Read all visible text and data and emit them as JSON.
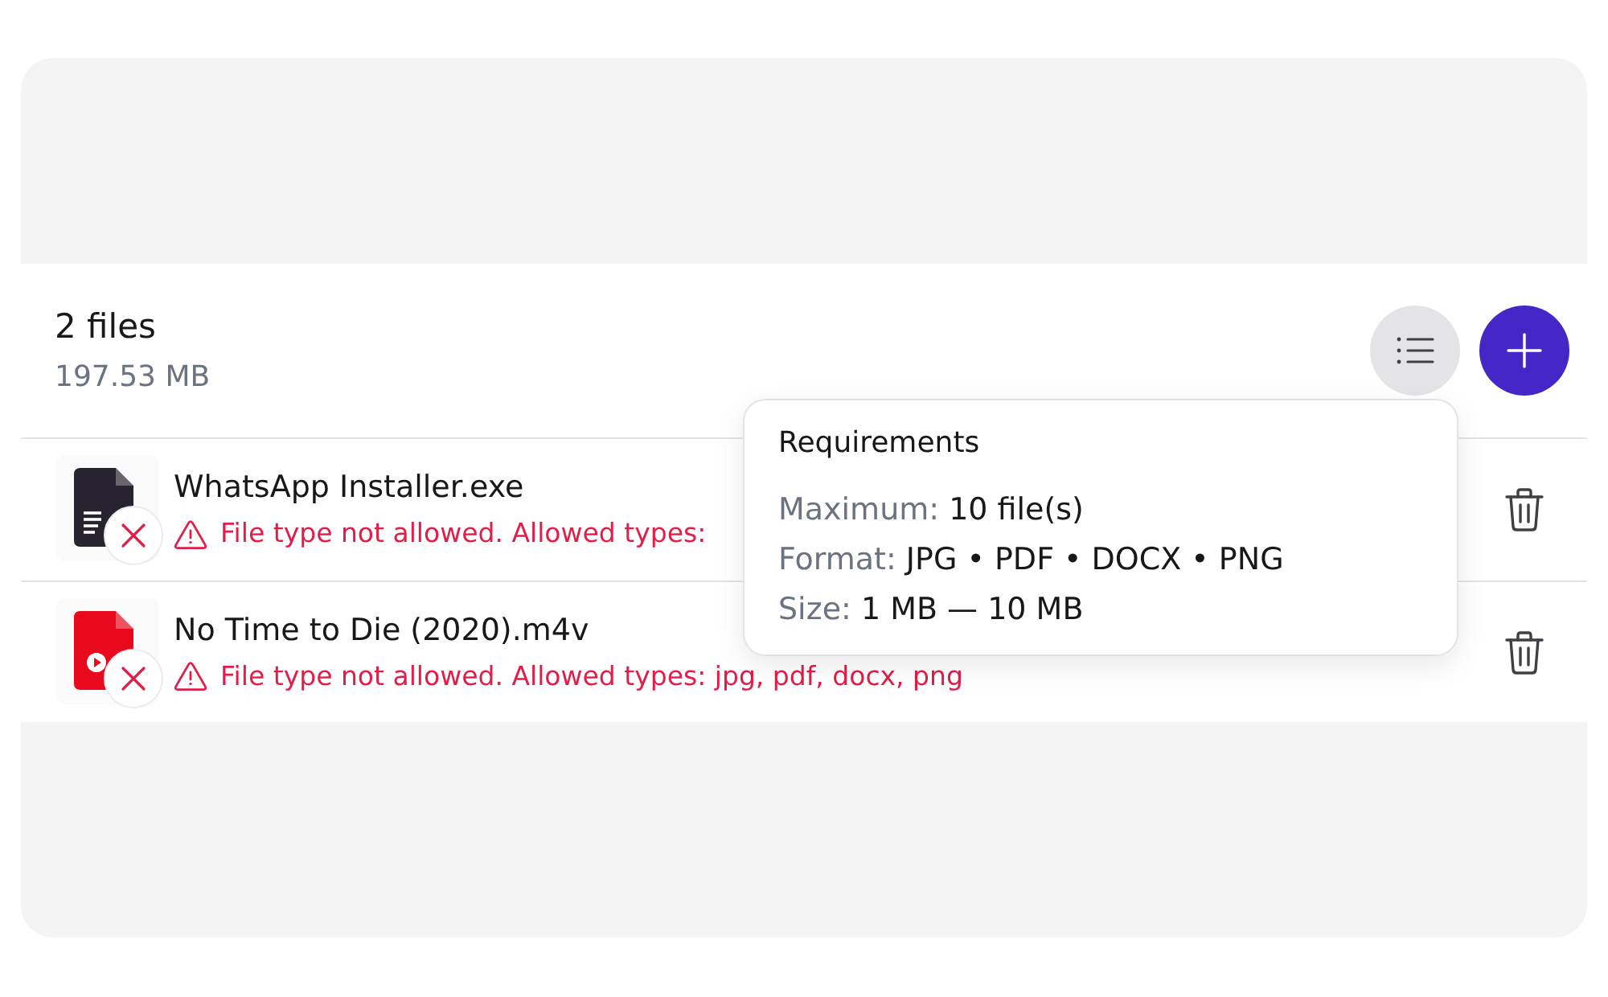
{
  "summary": {
    "title": "2 files",
    "size": "197.53 MB"
  },
  "requirements_toggle": {
    "expanded": true
  },
  "requirements": {
    "title": "Requirements",
    "items": [
      {
        "label": "Maximum:",
        "value": "10 file(s)"
      },
      {
        "label": "Format:",
        "value": "JPG • PDF • DOCX • PNG"
      },
      {
        "label": "Size:",
        "value": "1 MB — 10 MB"
      }
    ]
  },
  "files": [
    {
      "kind": "document",
      "color": "#27232f",
      "name": "WhatsApp Installer.exe",
      "error": "File type not allowed. Allowed types:"
    },
    {
      "kind": "video",
      "color": "#e8091e",
      "name": "No Time to Die (2020).m4v",
      "error": "File type not allowed. Allowed types: jpg, pdf, docx, png"
    }
  ]
}
